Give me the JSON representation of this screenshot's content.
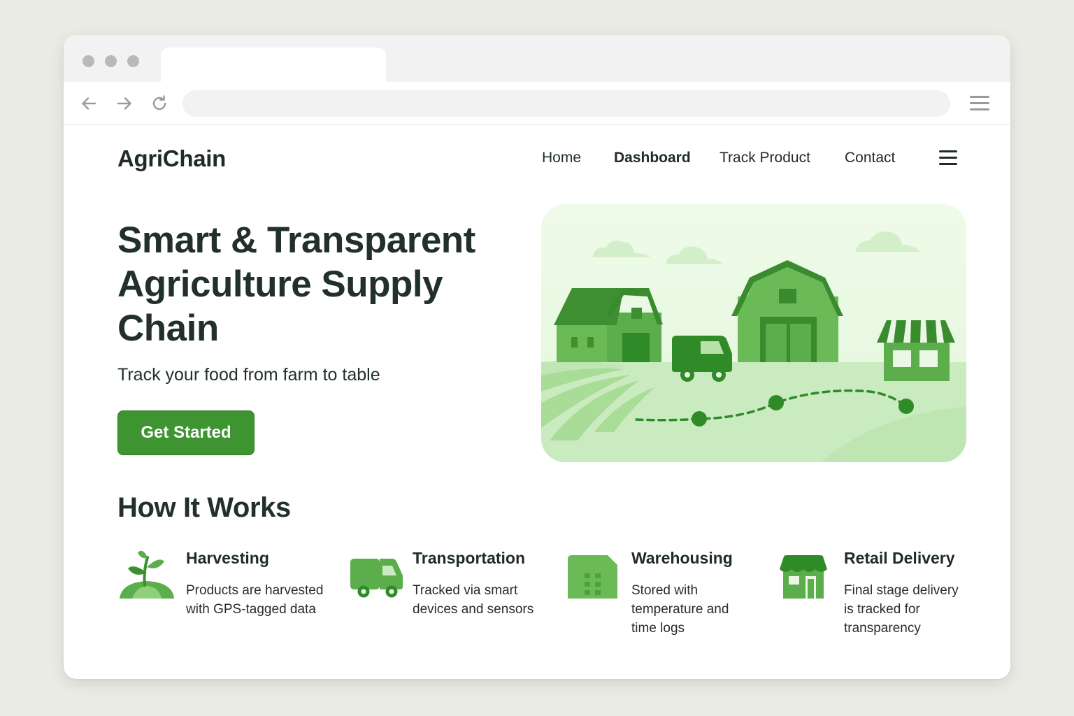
{
  "nav": {
    "brand": "AgriChain",
    "links": [
      "Home",
      "Dashboard",
      "Track Product",
      "Contact"
    ],
    "active": "Dashboard"
  },
  "hero": {
    "title": "Smart & Transparent Agriculture Supply Chain",
    "subtitle": "Track your food from farm to table",
    "cta_label": "Get Started"
  },
  "how_it_works": {
    "title": "How It Works",
    "steps": [
      {
        "icon": "sprout-icon",
        "title": "Harvesting",
        "description": "Products are harvested with GPS-tagged data"
      },
      {
        "icon": "delivery-van-icon",
        "title": "Transportation",
        "description": "Tracked via smart devices and sensors"
      },
      {
        "icon": "warehouse-building-icon",
        "title": "Warehousing",
        "description": "Stored with temperature and time logs"
      },
      {
        "icon": "retail-store-icon",
        "title": "Retail Delivery",
        "description": "Final stage delivery is tracked for transparency"
      }
    ]
  },
  "colors": {
    "primary_green": "#3d9430",
    "light_green": "#c9ebbf",
    "text_dark": "#22302a",
    "page_bg": "#ebebe5"
  }
}
